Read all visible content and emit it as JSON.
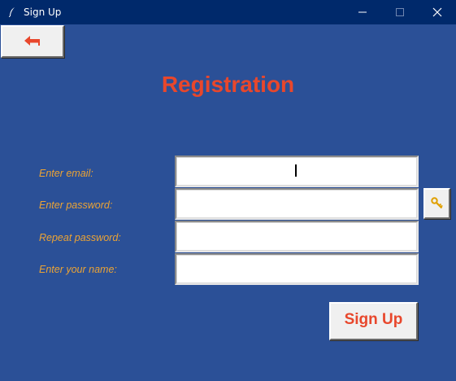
{
  "window": {
    "title": "Sign Up",
    "icon": "feather-icon",
    "controls": [
      "minimize-icon",
      "maximize-icon",
      "close-icon"
    ]
  },
  "toolbar": {
    "back_icon": "back-arrow-icon"
  },
  "heading": {
    "title": "Registration"
  },
  "form": {
    "fields": [
      {
        "label": "Enter email:",
        "value": ""
      },
      {
        "label": "Enter password:",
        "value": ""
      },
      {
        "label": "Repeat password:",
        "value": ""
      },
      {
        "label": "Enter your name:",
        "value": ""
      }
    ],
    "key_icon": "key-icon",
    "submit_label": "Sign Up"
  },
  "colors": {
    "background": "#2b5097",
    "titlebar": "#00296b",
    "title_text": "#e8472c",
    "label_text": "#eba335",
    "button_face": "#f0f0f0"
  }
}
